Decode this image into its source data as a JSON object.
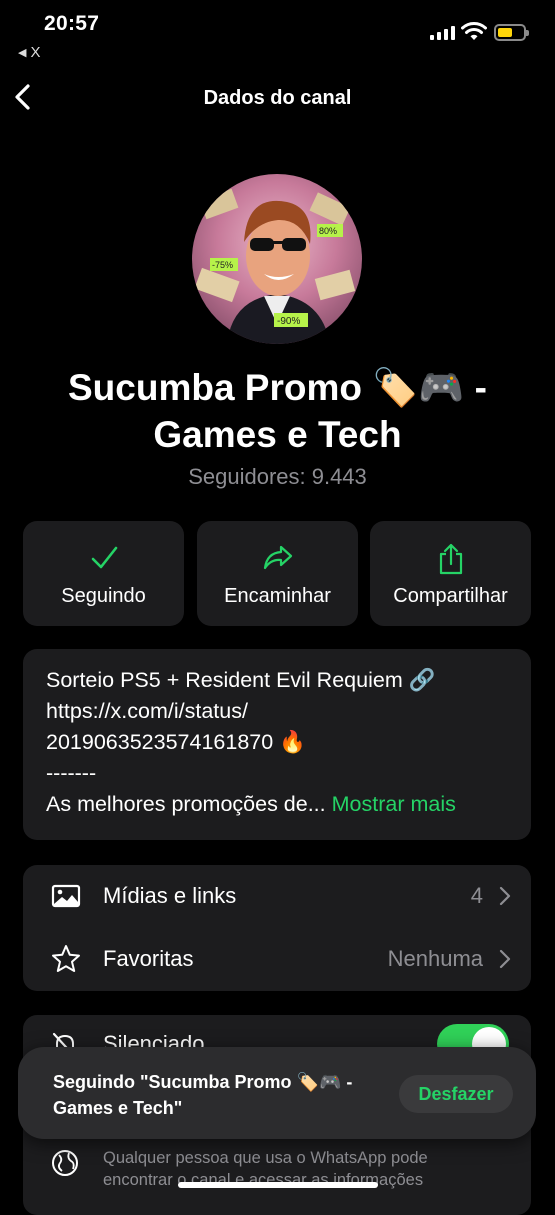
{
  "status_bar": {
    "time": "20:57",
    "back_app": "X"
  },
  "header": {
    "title": "Dados do canal"
  },
  "channel": {
    "name_line1": "Sucumba Promo 🏷️🎮  -",
    "name_line2": "Games e Tech",
    "followers": "Seguidores: 9.443",
    "avatar_badges": [
      "80%",
      "-75%",
      "-90%"
    ]
  },
  "actions": [
    {
      "label": "Seguindo",
      "icon": "checkmark-icon"
    },
    {
      "label": "Encaminhar",
      "icon": "forward-icon"
    },
    {
      "label": "Compartilhar",
      "icon": "share-icon"
    }
  ],
  "description": {
    "line1": "Sorteio PS5 + Resident Evil Requiem 🔗",
    "line2": "https://x.com/i/status/",
    "line3": "2019063523574161870 🔥",
    "line4": "-------",
    "line5": "As melhores promoções de...",
    "more": "Mostrar mais"
  },
  "list": [
    {
      "label": "Mídias e links",
      "value": "4",
      "icon": "image-icon"
    },
    {
      "label": "Favoritas",
      "value": "Nenhuma",
      "icon": "star-icon"
    }
  ],
  "settings": {
    "silenced_label": "Silenciado",
    "privacy_text": "Qualquer pessoa que usa o WhatsApp pode encontrar o canal e acessar as informações"
  },
  "toast": {
    "text_line1": "Seguindo \"Sucumba Promo 🏷️🎮  -",
    "text_line2": "Games e Tech\"",
    "undo": "Desfazer"
  },
  "colors": {
    "accent": "#25d366",
    "card": "#1c1c1e",
    "toggle": "#30d158"
  }
}
